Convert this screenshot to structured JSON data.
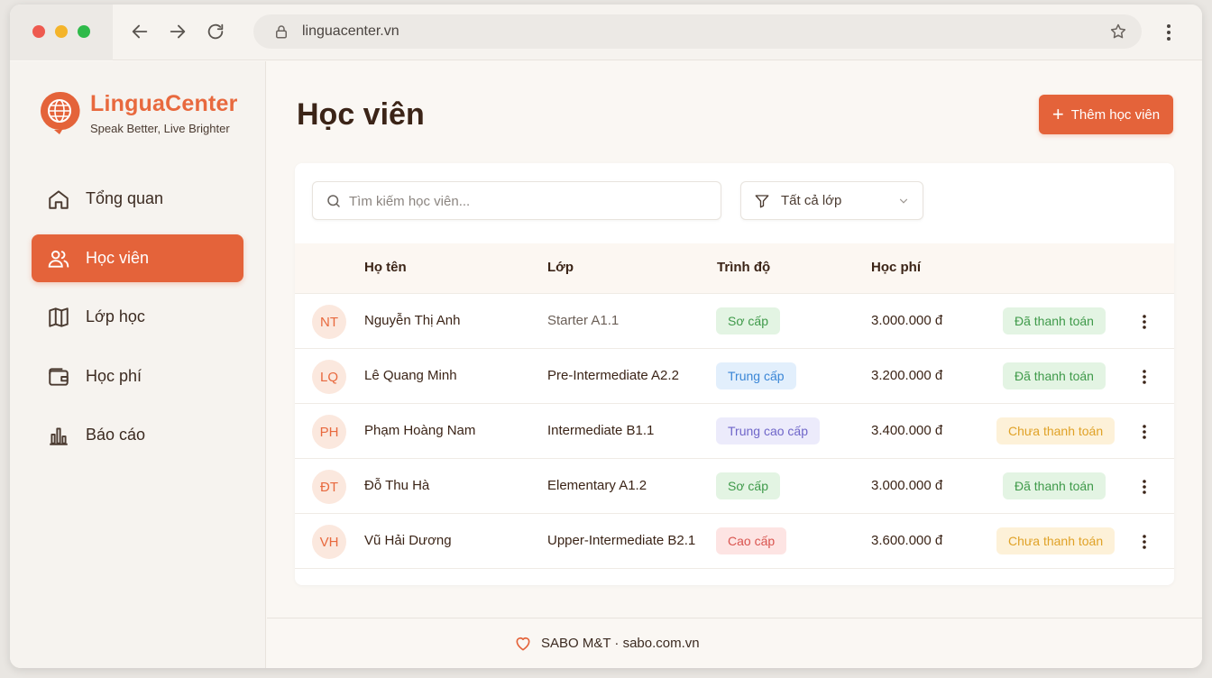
{
  "browser": {
    "url": "linguacenter.vn"
  },
  "brand": {
    "name": "LinguaCenter",
    "tagline": "Speak Better, Live Brighter",
    "accent_color": "#e4633a"
  },
  "sidebar": {
    "items": [
      {
        "label": "Tổng quan",
        "icon": "home-icon",
        "active": false
      },
      {
        "label": "Học viên",
        "icon": "users-icon",
        "active": true
      },
      {
        "label": "Lớp học",
        "icon": "book-icon",
        "active": false
      },
      {
        "label": "Học phí",
        "icon": "wallet-icon",
        "active": false
      },
      {
        "label": "Báo cáo",
        "icon": "bar-chart-icon",
        "active": false
      }
    ]
  },
  "main": {
    "title": "Học viên",
    "add_button_label": "Thêm học viên",
    "search_placeholder": "Tìm kiếm học viên...",
    "filter_label": "Tất cả lớp",
    "columns": [
      "Họ tên",
      "Lớp",
      "Trình độ",
      "Học phí"
    ],
    "rows": [
      {
        "initials": "NT",
        "name": "Nguyễn Thị Anh",
        "class": "Starter A1.1",
        "level": "Sơ cấp",
        "level_tone": "green",
        "fee": "3.000.000 đ",
        "status": "Đã thanh toán",
        "status_tone": "green"
      },
      {
        "initials": "LQ",
        "name": "Lê Quang Minh",
        "class": "Pre-Intermediate A2.2",
        "level": "Trung cấp",
        "level_tone": "blue",
        "fee": "3.200.000 đ",
        "status": "Đã thanh toán",
        "status_tone": "green"
      },
      {
        "initials": "PH",
        "name": "Phạm Hoàng Nam",
        "class": "Intermediate B1.1",
        "level": "Trung cao cấp",
        "level_tone": "purple",
        "fee": "3.400.000 đ",
        "status": "Chưa thanh toán",
        "status_tone": "yellow"
      },
      {
        "initials": "ĐT",
        "name": "Đỗ Thu Hà",
        "class": "Elementary A1.2",
        "level": "Sơ cấp",
        "level_tone": "green",
        "fee": "3.000.000 đ",
        "status": "Đã thanh toán",
        "status_tone": "green"
      },
      {
        "initials": "VH",
        "name": "Vũ Hải Dương",
        "class": "Upper-Intermediate B2.1",
        "level": "Cao cấp",
        "level_tone": "red",
        "fee": "3.600.000 đ",
        "status": "Chưa thanh toán",
        "status_tone": "yellow"
      }
    ]
  },
  "footer": {
    "text": "SABO M&T · sabo.com.vn",
    "icon": "heart-icon"
  },
  "tones": {
    "green": {
      "bg": "#e3f4e3",
      "fg": "#3f9a4a"
    },
    "blue": {
      "bg": "#e2effc",
      "fg": "#3a86d6"
    },
    "purple": {
      "bg": "#ecebfb",
      "fg": "#6f66c9"
    },
    "red": {
      "bg": "#fde4e3",
      "fg": "#d9544f"
    },
    "yellow": {
      "bg": "#fdf1d8",
      "fg": "#e0a227"
    }
  }
}
